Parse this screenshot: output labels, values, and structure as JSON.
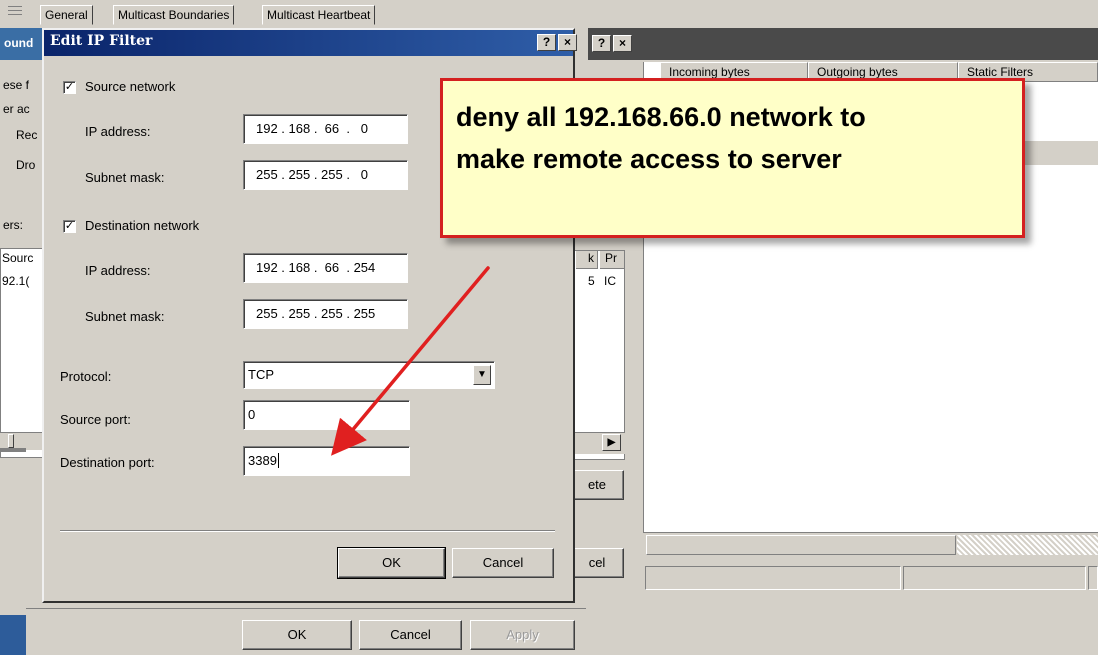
{
  "background_window": {
    "columns": [
      "Incoming bytes",
      "Outgoing bytes",
      "Static Filters"
    ],
    "help_label": "?",
    "close_label": "×",
    "partial_button_top": "ete",
    "partial_button_bottom": "cel",
    "scroll_arrow": "▶"
  },
  "properties_window": {
    "tabs": [
      "General",
      "Multicast Boundaries",
      "Multicast Heartbeat"
    ],
    "strip_title": "ound",
    "strip_lines": [
      "ese f",
      "er ac",
      "Rec",
      "Dro",
      "ers:"
    ],
    "list_header": "Sourc",
    "list_row": "92.1(",
    "list2_header_a": "k",
    "list2_header_b": "Pr",
    "list2_cell_a": "5",
    "list2_cell_b": "IC",
    "buttons": {
      "ok": "OK",
      "cancel": "Cancel",
      "apply": "Apply"
    }
  },
  "dialog": {
    "title": "Edit IP Filter",
    "help_label": "?",
    "close_label": "×",
    "source_network": {
      "checked": true,
      "label": "Source network",
      "ip_label": "IP address:",
      "ip_value": "192 . 168 .  66  .   0",
      "mask_label": "Subnet mask:",
      "mask_value": "255 . 255 . 255 .   0"
    },
    "destination_network": {
      "checked": true,
      "label": "Destination network",
      "ip_label": "IP address:",
      "ip_value": "192 . 168 .  66  . 254",
      "mask_label": "Subnet mask:",
      "mask_value": "255 . 255 . 255 . 255"
    },
    "protocol_label": "Protocol:",
    "protocol_value": "TCP",
    "source_port_label": "Source port:",
    "source_port_value": "0",
    "destination_port_label": "Destination port:",
    "destination_port_value": "3389",
    "ok_label": "OK",
    "cancel_label": "Cancel"
  },
  "callout": {
    "line1": "deny all 192.168.66.0 network to",
    "line2": "make remote access to server",
    "border_color": "#d42020",
    "fill_color": "#ffffc8"
  },
  "arrow_color": "#e02020"
}
